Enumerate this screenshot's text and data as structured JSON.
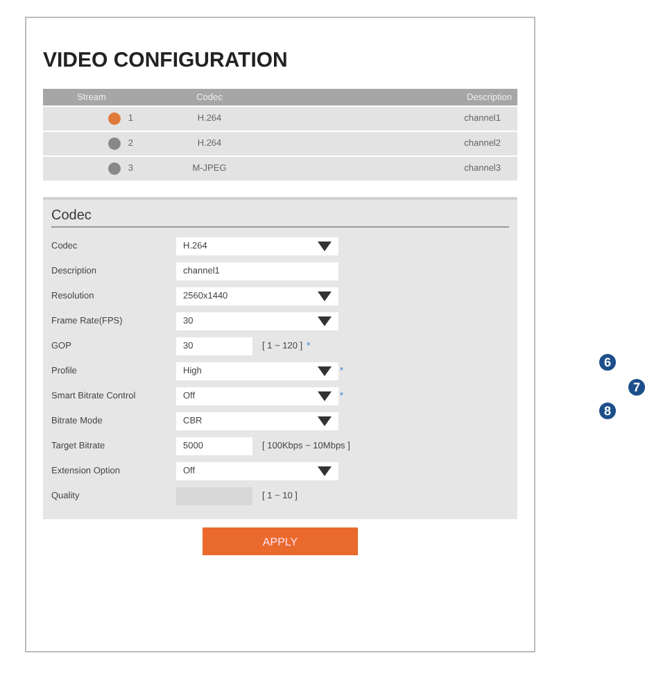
{
  "title": "VIDEO CONFIGURATION",
  "streams": {
    "columns": [
      "Stream",
      "Codec",
      "Description"
    ],
    "rows": [
      {
        "stream": "1",
        "codec": "H.264",
        "description": "channel1",
        "selected": true
      },
      {
        "stream": "2",
        "codec": "H.264",
        "description": "channel2",
        "selected": false
      },
      {
        "stream": "3",
        "codec": "M-JPEG",
        "description": "channel3",
        "selected": false
      }
    ]
  },
  "codec_panel": {
    "heading": "Codec",
    "fields": [
      {
        "label": "Codec",
        "kind": "select",
        "value": "H.264"
      },
      {
        "label": "Description",
        "kind": "text",
        "value": "channel1"
      },
      {
        "label": "Resolution",
        "kind": "select",
        "value": "2560x1440"
      },
      {
        "label": "Frame Rate(FPS)",
        "kind": "select",
        "value": "30"
      },
      {
        "label": "GOP",
        "kind": "short",
        "value": "30",
        "range": "[ 1 ~ 120 ]",
        "note": "*"
      },
      {
        "label": "Profile",
        "kind": "select",
        "value": "High",
        "note": "*"
      },
      {
        "label": "Smart Bitrate Control",
        "kind": "select",
        "value": "Off",
        "note": "*"
      },
      {
        "label": "Bitrate Mode",
        "kind": "select",
        "value": "CBR"
      },
      {
        "label": "Target Bitrate",
        "kind": "short",
        "value": "5000",
        "range": "[ 100Kbps ~ 10Mbps ]"
      },
      {
        "label": "Extension Option",
        "kind": "select",
        "value": "Off"
      },
      {
        "label": "Quality",
        "kind": "short",
        "range": "[ 1 ~ 10 ]",
        "disabled": true
      }
    ]
  },
  "apply_button": "APPLY",
  "callouts": [
    "6",
    "7",
    "8"
  ]
}
